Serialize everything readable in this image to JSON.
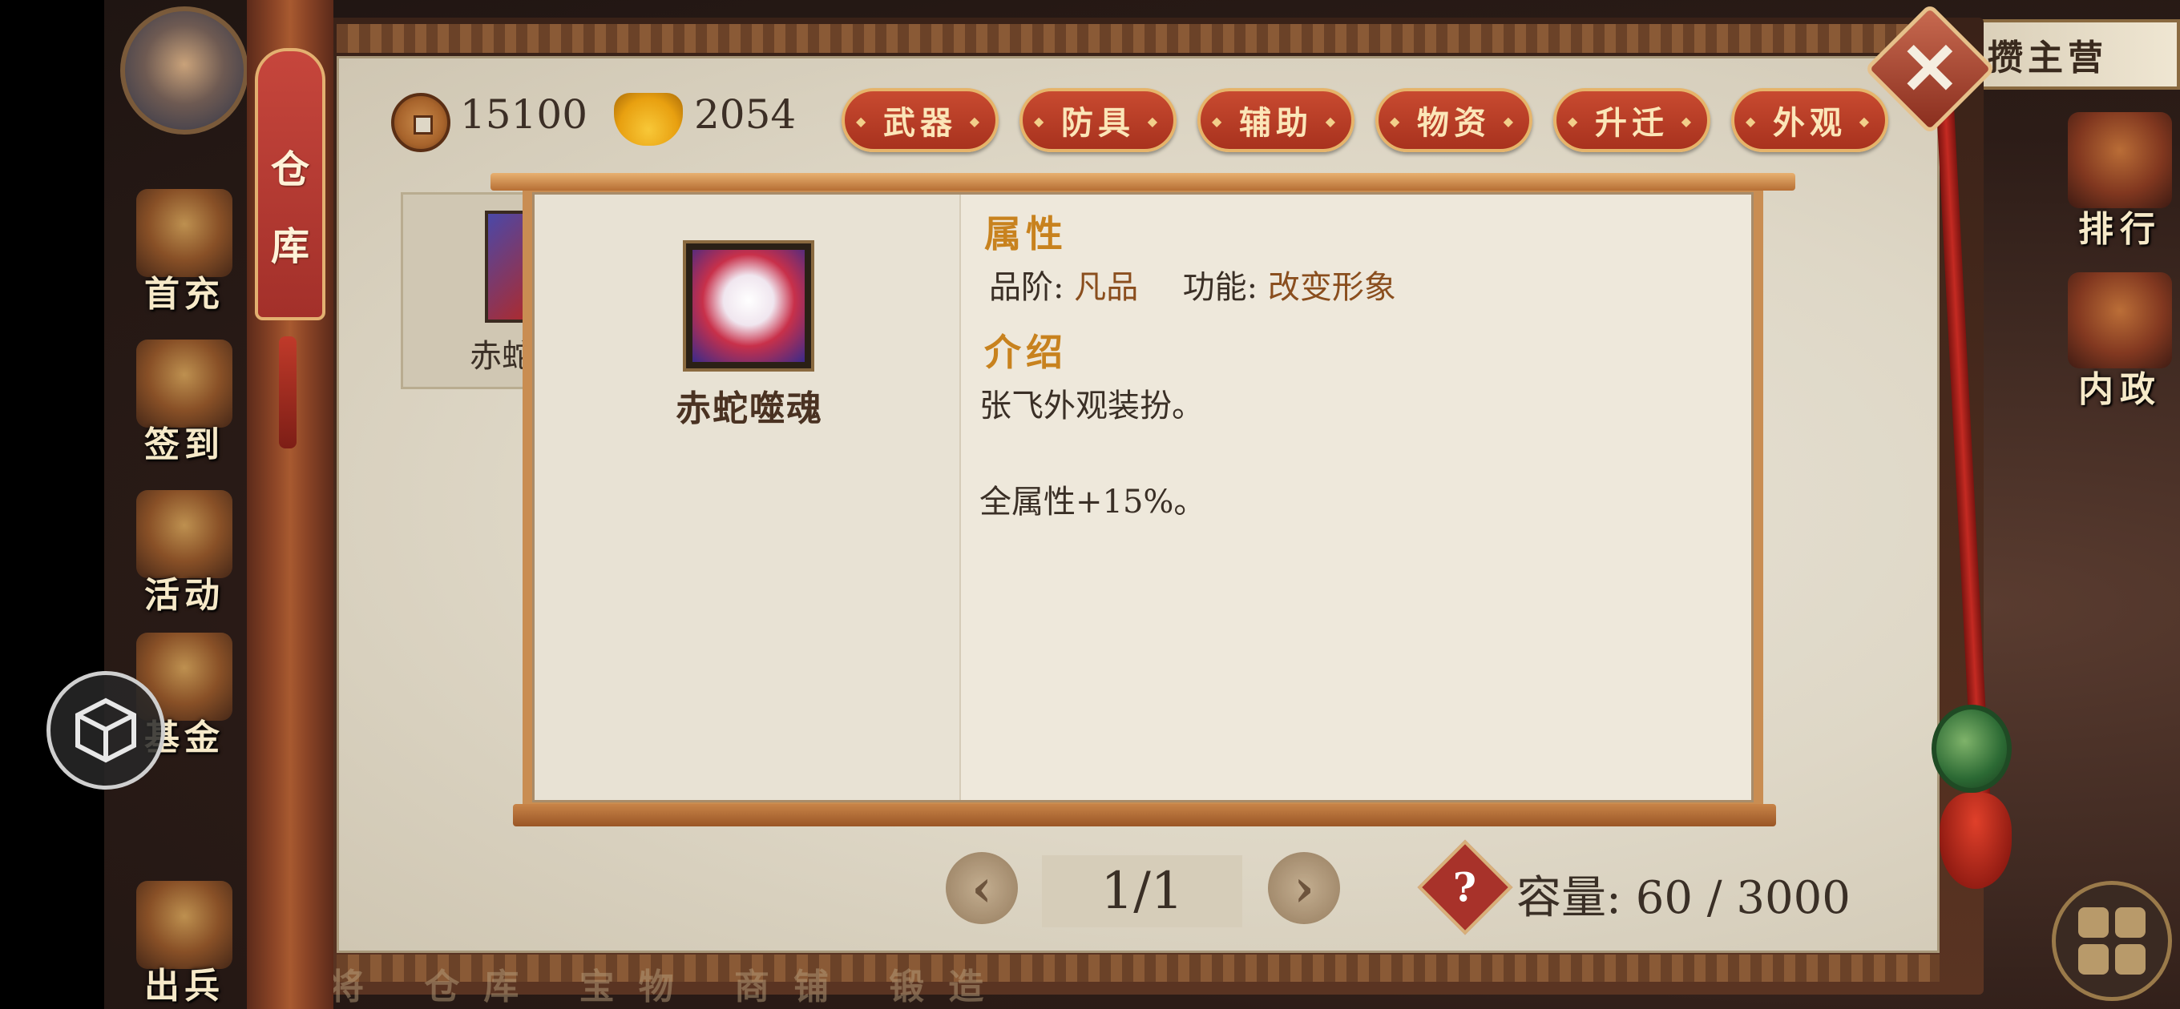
{
  "header": {
    "title": "仓库",
    "right_title": "攒主营"
  },
  "currency": {
    "copper": "15100",
    "gold_ingot": "2054"
  },
  "tabs": [
    {
      "label": "武器"
    },
    {
      "label": "防具"
    },
    {
      "label": "辅助"
    },
    {
      "label": "物资"
    },
    {
      "label": "升迁"
    },
    {
      "label": "外观"
    }
  ],
  "left_menu": [
    {
      "label": "首充",
      "icon": "first-charge-icon"
    },
    {
      "label": "签到",
      "icon": "checkin-icon"
    },
    {
      "label": "活动",
      "icon": "events-icon"
    },
    {
      "label": "基金",
      "icon": "fund-icon"
    },
    {
      "label": "出兵",
      "icon": "deploy-icon"
    }
  ],
  "right_menu": [
    {
      "label": "排行",
      "icon": "ranking-icon"
    },
    {
      "label": "内政",
      "icon": "domestic-icon"
    }
  ],
  "slot": {
    "name_partial": "赤蛇"
  },
  "detail": {
    "item_name": "赤蛇噬魂",
    "attributes_title": "属性",
    "grade_label": "品阶:",
    "grade_value": "凡品",
    "function_label": "功能:",
    "function_value": "改变形象",
    "intro_title": "介绍",
    "desc_line1": "张飞外观装扮。",
    "desc_line2": "全属性+15%。"
  },
  "pagination": {
    "page": "1/1"
  },
  "capacity": {
    "label": "容量:",
    "value": "60 / 3000"
  },
  "bottom_faded_text": "将 仓库 宝物 商铺 锻造",
  "colors": {
    "tab_red": "#b03a24",
    "accent_gold": "#c8821e",
    "paper": "#eee8db"
  }
}
